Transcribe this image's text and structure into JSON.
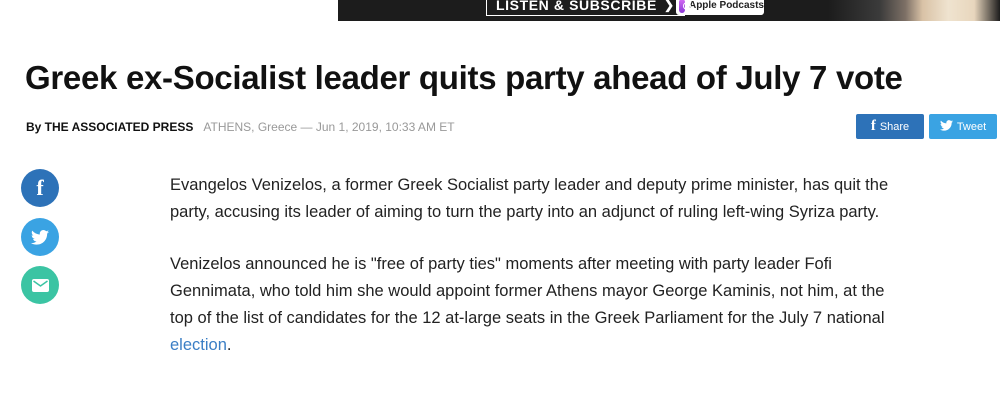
{
  "banner": {
    "cta_label": "LISTEN & SUBSCRIBE",
    "cta_chevron": "❯",
    "podcast_label": "Apple Podcasts"
  },
  "article": {
    "headline": "Greek ex-Socialist leader quits party ahead of July 7 vote",
    "byline": "By THE ASSOCIATED PRESS",
    "meta": "ATHENS, Greece — Jun 1, 2019, 10:33 AM ET",
    "paragraph1": "Evangelos Venizelos, a former Greek Socialist party leader and deputy prime minister, has quit the party, accusing its leader of aiming to turn the party into an adjunct of ruling left-wing Syriza party.",
    "paragraph2_text": "Venizelos announced he is \"free of party ties\" moments after meeting with party leader Fofi Gennimata, who told him she would appoint former Athens mayor George Kaminis, not him, at the top of the list of candidates for the 12 at-large seats in the Greek Parliament for the July 7 national ",
    "paragraph2_link": "election",
    "paragraph2_end": "."
  },
  "share": {
    "facebook_label": "Share",
    "twitter_label": "Tweet",
    "facebook_icon": "f"
  },
  "colors": {
    "facebook": "#2d72b8",
    "twitter": "#3aa3e3",
    "email": "#3bc4a3",
    "link": "#3a7ec5"
  }
}
